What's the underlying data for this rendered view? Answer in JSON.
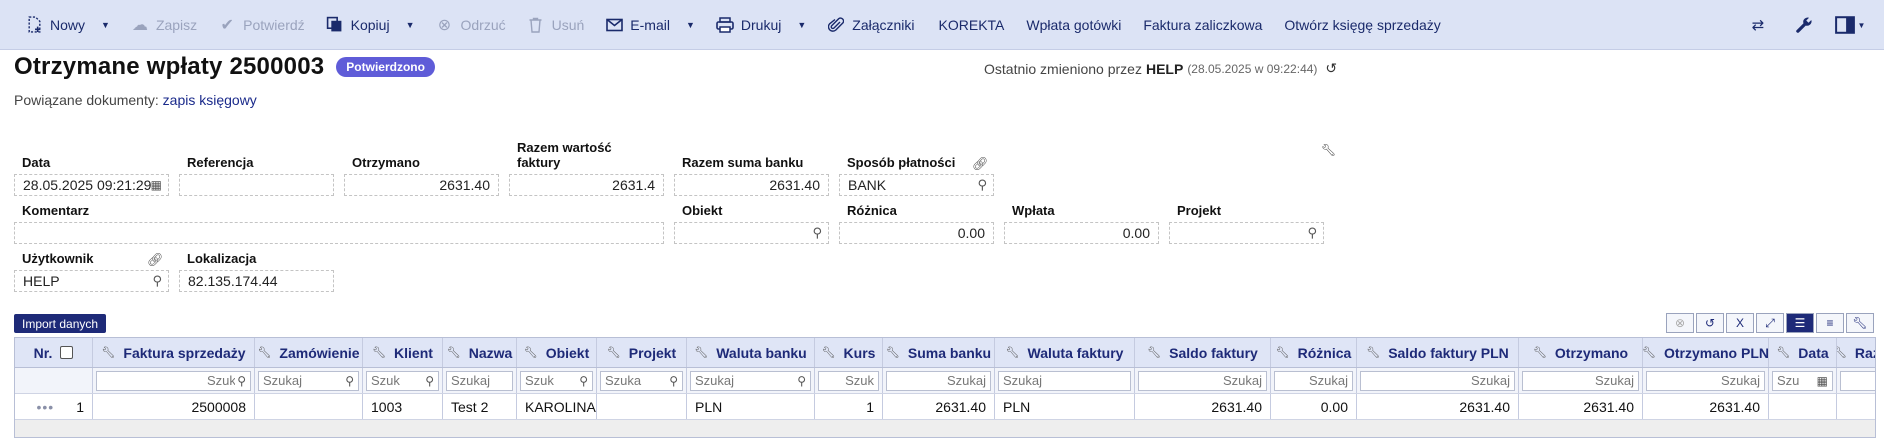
{
  "toolbar": {
    "items": [
      {
        "label": "Nowy",
        "icon": "new-document-icon",
        "caret": true,
        "disabled": false
      },
      {
        "label": "Zapisz",
        "icon": "cloud-upload-icon",
        "caret": false,
        "disabled": true
      },
      {
        "label": "Potwierdź",
        "icon": "checkmark-icon",
        "caret": false,
        "disabled": true
      },
      {
        "label": "Kopiuj",
        "icon": "copy-icon",
        "caret": true,
        "disabled": false
      },
      {
        "label": "Odrzuć",
        "icon": "reject-circle-icon",
        "caret": false,
        "disabled": true
      },
      {
        "label": "Usuń",
        "icon": "trash-icon",
        "caret": false,
        "disabled": true
      },
      {
        "label": "E-mail",
        "icon": "envelope-icon",
        "caret": true,
        "disabled": false
      },
      {
        "label": "Drukuj",
        "icon": "printer-icon",
        "caret": true,
        "disabled": false
      },
      {
        "label": "Załączniki",
        "icon": "paperclip-icon",
        "caret": false,
        "disabled": false
      },
      {
        "label": "KOREKTA",
        "icon": "",
        "caret": false,
        "disabled": false
      },
      {
        "label": "Wpłata gotówki",
        "icon": "",
        "caret": false,
        "disabled": false
      },
      {
        "label": "Faktura zaliczkowa",
        "icon": "",
        "caret": false,
        "disabled": false
      },
      {
        "label": "Otwórz księgę sprzedaży",
        "icon": "",
        "caret": false,
        "disabled": false
      }
    ]
  },
  "header": {
    "title": "Otrzymane wpłaty 2500003",
    "status": "Potwierdzono",
    "last_changed_prefix": "Ostatnio zmieniono przez",
    "last_changed_user": "HELP",
    "last_changed_time": "(28.05.2025 w 09:22:44)",
    "related_prefix": "Powiązane dokumenty:",
    "related_link": "zapis księgowy"
  },
  "form": {
    "data_label": "Data",
    "data_value": "28.05.2025 09:21:29",
    "referencja_label": "Referencja",
    "referencja_value": "",
    "otrzymano_label": "Otrzymano",
    "otrzymano_value": "2631.40",
    "razem_wartosc_label": "Razem wartość faktury",
    "razem_wartosc_value": "2631.4",
    "razem_suma_label": "Razem suma banku",
    "razem_suma_value": "2631.40",
    "sposob_label": "Sposób płatności",
    "sposob_value": "BANK",
    "komentarz_label": "Komentarz",
    "komentarz_value": "",
    "obiekt_label": "Obiekt",
    "obiekt_value": "",
    "roznica_label": "Różnica",
    "roznica_value": "0.00",
    "wplata_label": "Wpłata",
    "wplata_value": "0.00",
    "projekt_label": "Projekt",
    "projekt_value": "",
    "uzytkownik_label": "Użytkownik",
    "uzytkownik_value": "HELP",
    "lokalizacja_label": "Lokalizacja",
    "lokalizacja_value": "82.135.174.44"
  },
  "grid": {
    "import_label": "Import danych",
    "search_placeholder": "Szukaj",
    "columns": [
      "Nr.",
      "Faktura sprzedaży",
      "Zamówienie",
      "Klient",
      "Nazwa",
      "Obiekt",
      "Projekt",
      "Waluta banku",
      "Kurs",
      "Suma banku",
      "Waluta faktury",
      "Saldo faktury",
      "Różnica",
      "Saldo faktury PLN",
      "Otrzymano",
      "Otrzymano PLN",
      "Data",
      "Razem"
    ],
    "filter_placeholders": [
      "",
      "Szukaj",
      "Szukaj",
      "Szuk",
      "Szukaj",
      "Szuk",
      "Szuka",
      "Szukaj",
      "Szuk",
      "Szukaj",
      "Szukaj",
      "Szukaj",
      "Szukaj",
      "Szukaj",
      "Szukaj",
      "Szukaj",
      "Szu",
      ""
    ],
    "rows": [
      [
        "1",
        "2500008",
        "",
        "1003",
        "Test 2",
        "KAROLINA",
        "",
        "PLN",
        "1",
        "2631.40",
        "PLN",
        "2631.40",
        "0.00",
        "2631.40",
        "2631.40",
        "2631.40",
        "",
        ""
      ]
    ]
  }
}
